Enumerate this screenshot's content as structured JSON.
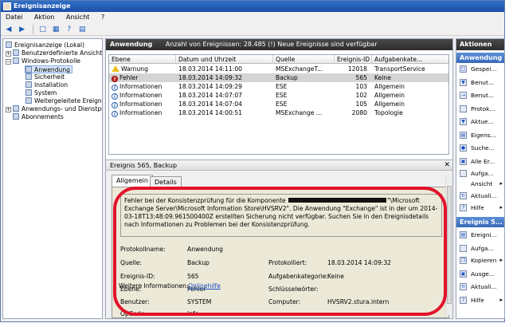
{
  "window": {
    "title": "Ereignisanzeige"
  },
  "menu": [
    "Datei",
    "Aktion",
    "Ansicht",
    "?"
  ],
  "toolbar": {
    "icons": [
      "back-icon",
      "forward-icon",
      "folder-up-icon",
      "show-hide-tree-icon",
      "help-icon",
      "properties-icon"
    ]
  },
  "nav": {
    "items": [
      {
        "label": "Ereignisanzeige (Lokal)",
        "icon": "event-viewer-icon"
      },
      {
        "label": "Benutzerdefinierte Ansichten",
        "icon": "folder-icon"
      },
      {
        "label": "Windows-Protokolle",
        "icon": "folder-icon"
      },
      {
        "label": "Anwendung",
        "icon": "log-icon"
      },
      {
        "label": "Sicherheit",
        "icon": "log-icon"
      },
      {
        "label": "Installation",
        "icon": "log-icon"
      },
      {
        "label": "System",
        "icon": "log-icon"
      },
      {
        "label": "Weitergeleitete Ereignisse",
        "icon": "log-icon"
      },
      {
        "label": "Anwendungs- und Dienstprotokolle",
        "icon": "folder-icon"
      },
      {
        "label": "Abonnements",
        "icon": "subscription-icon"
      }
    ]
  },
  "log_header": {
    "name": "Anwendung",
    "info": "Anzahl von Ereignissen: 28.485 (!) Neue Ereignisse sind verfügbar"
  },
  "grid": {
    "columns": [
      "Ebene",
      "Datum und Uhrzeit",
      "Quelle",
      "Ereignis-ID",
      "Aufgabenkate..."
    ],
    "rows": [
      {
        "level": "Warnung",
        "icon": "warning-icon",
        "date": "18.03.2014 14:11:00",
        "source": "MSExchangeT...",
        "id": "12018",
        "category": "TransportService"
      },
      {
        "level": "Fehler",
        "icon": "error-icon",
        "date": "18.03.2014 14:09:32",
        "source": "Backup",
        "id": "565",
        "category": "Keine"
      },
      {
        "level": "Informationen",
        "icon": "info-icon",
        "date": "18.03.2014 14:09:29",
        "source": "ESE",
        "id": "103",
        "category": "Allgemein"
      },
      {
        "level": "Informationen",
        "icon": "info-icon",
        "date": "18.03.2014 14:07:07",
        "source": "ESE",
        "id": "102",
        "category": "Allgemein"
      },
      {
        "level": "Informationen",
        "icon": "info-icon",
        "date": "18.03.2014 14:07:04",
        "source": "ESE",
        "id": "105",
        "category": "Allgemein"
      },
      {
        "level": "Informationen",
        "icon": "info-icon",
        "date": "18.03.2014 14:00:51",
        "source": "MSExchange ...",
        "id": "2080",
        "category": "Topologie"
      }
    ]
  },
  "detail": {
    "title": "Ereignis 565, Backup",
    "tabs": [
      "Allgemein",
      "Details"
    ],
    "message_part1": "Fehler bei der Konsistenzprüfung für die Komponente",
    "message_part2": "\"\\Microsoft Exchange Server\\Microsoft Information Store\\HVSRV2\". Die Anwendung \"Exchange\" ist in der um 2014-03-18T13:48:09.961500400Z erstellten Sicherung nicht verfügbar. Suchen Sie in den Ereignisdetails nach Informationen zu Problemen bei der Konsistenzprüfung.",
    "labels": {
      "protokollname": "Protokollname:",
      "quelle": "Quelle:",
      "ereignis_id": "Ereignis-ID:",
      "ebene": "Ebene:",
      "benutzer": "Benutzer:",
      "opcode": "OpCode:",
      "weitere": "Weitere Informationen:",
      "protokolliert": "Protokolliert:",
      "aufgabenkategorie": "Aufgabenkategorie:",
      "schluesselwoerter": "Schlüsselwörter:",
      "computer": "Computer:"
    },
    "values": {
      "protokollname": "Anwendung",
      "quelle": "Backup",
      "ereignis_id": "565",
      "ebene": "Fehler",
      "benutzer": "SYSTEM",
      "opcode": "Info",
      "weitere_link": "Onlinehilfe",
      "protokolliert": "18.03.2014 14:09:32",
      "aufgabenkategorie": "Keine",
      "schluesselwoerter": "",
      "computer": "HVSRV2.stura.intern"
    },
    "highlight_color": "#e3122a"
  },
  "actions": {
    "title": "Aktionen",
    "sections": [
      {
        "title": "Anwendung",
        "items": [
          {
            "label": "Gespei...",
            "icon": "open-log-icon"
          },
          {
            "label": "Benut...",
            "icon": "filter-icon"
          },
          {
            "label": "Benut...",
            "icon": "import-icon"
          },
          {
            "label": "Protok...",
            "icon": "clear-log-icon"
          },
          {
            "label": "Aktue...",
            "icon": "filter-current-icon"
          },
          {
            "label": "Eigens...",
            "icon": "properties-icon"
          },
          {
            "label": "Suche...",
            "icon": "find-icon"
          },
          {
            "label": "Alle Er...",
            "icon": "save-events-icon"
          },
          {
            "label": "Aufga...",
            "icon": "attach-task-icon"
          },
          {
            "label": "Ansicht",
            "icon": "view-icon",
            "submenu": true
          },
          {
            "label": "Aktuali...",
            "icon": "refresh-icon"
          },
          {
            "label": "Hilfe",
            "icon": "help-icon",
            "submenu": true
          }
        ]
      },
      {
        "title": "Ereignis 5...",
        "items": [
          {
            "label": "Ereigni...",
            "icon": "event-properties-icon"
          },
          {
            "label": "Aufga...",
            "icon": "attach-task-icon"
          },
          {
            "label": "Kopieren",
            "icon": "copy-icon",
            "submenu": true
          },
          {
            "label": "Ausge...",
            "icon": "save-selected-icon"
          },
          {
            "label": "Aktuali...",
            "icon": "refresh-icon"
          },
          {
            "label": "Hilfe",
            "icon": "help-icon",
            "submenu": true
          }
        ]
      }
    ]
  }
}
